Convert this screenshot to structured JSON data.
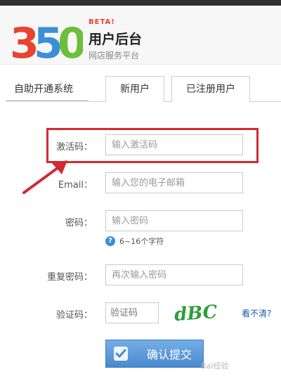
{
  "header": {
    "logo_text": "350",
    "beta": "BETA!",
    "title": "用户后台",
    "subtitle": "网店服务平台"
  },
  "tabs": {
    "self_service": "自助开通系统",
    "new_user": "新用户",
    "registered_user": "已注册用户"
  },
  "form": {
    "activation_label": "激活码：",
    "activation_placeholder": "输入激活码",
    "email_label": "Email：",
    "email_placeholder": "输入您的电子邮箱",
    "password_label": "密码：",
    "password_placeholder": "输入密码",
    "password_hint": "6~16个字符",
    "confirm_label": "重复密码：",
    "confirm_placeholder": "再次输入密码",
    "captcha_label": "验证码：",
    "captcha_placeholder": "验证码",
    "captcha_text": "dBC",
    "refresh_label": "看不清?",
    "submit_label": "确认提交"
  },
  "watermark": "Bai经验"
}
